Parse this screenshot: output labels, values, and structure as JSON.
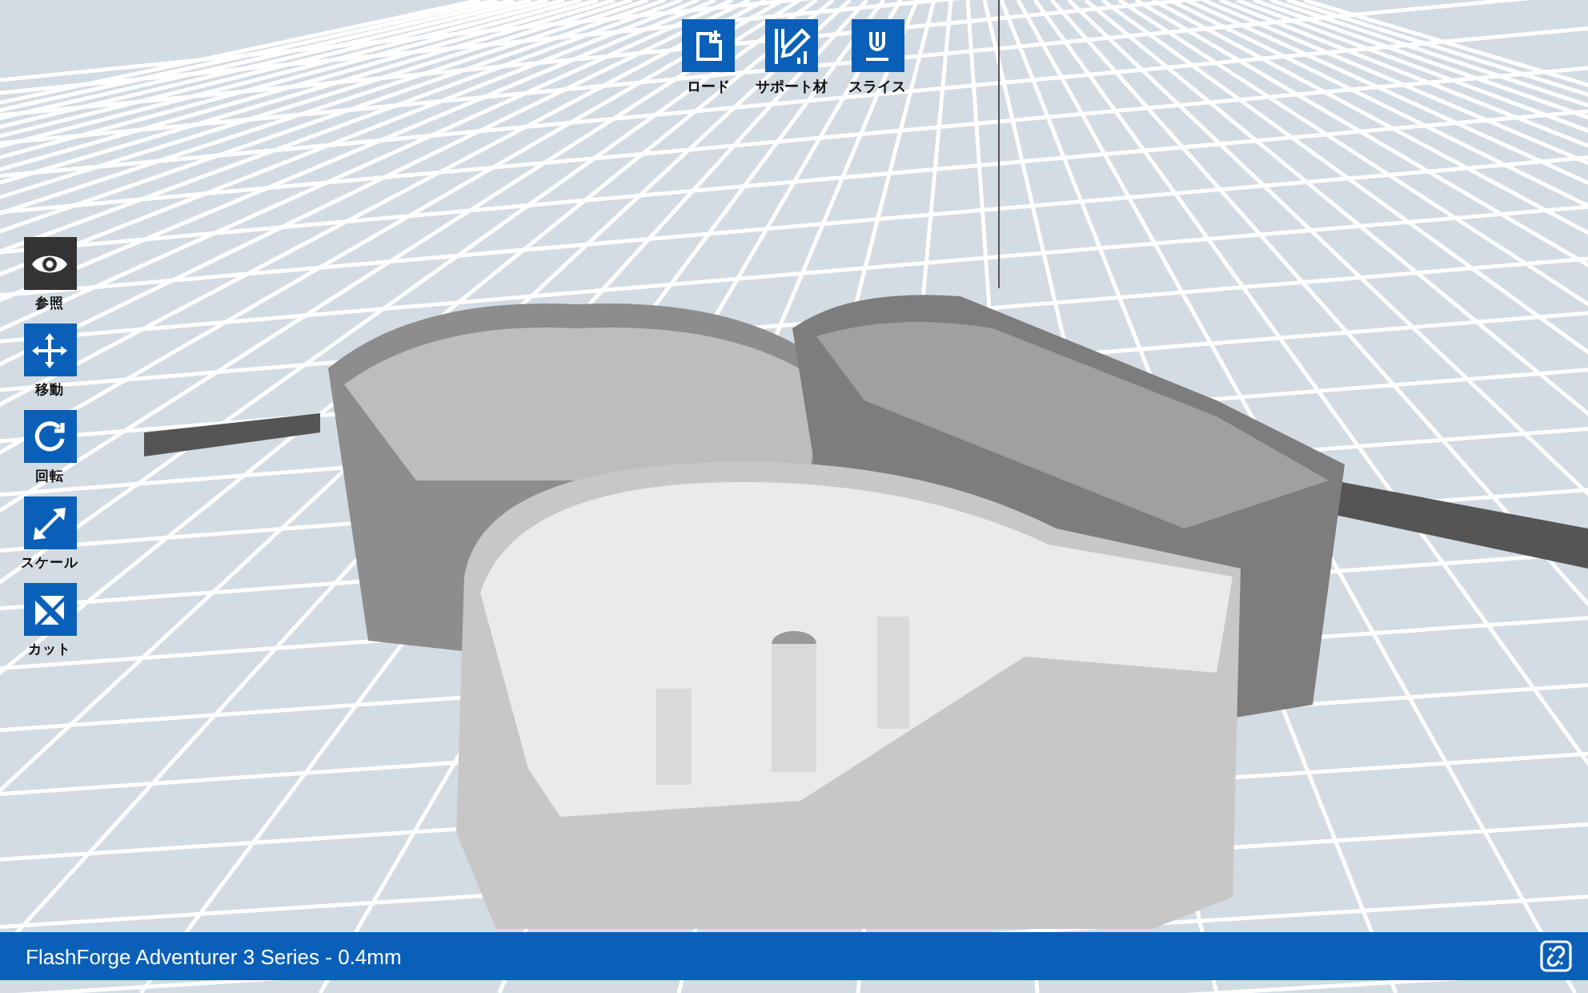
{
  "top_toolbar": [
    {
      "kind": "load",
      "label": "ロード"
    },
    {
      "kind": "support",
      "label": "サポート材"
    },
    {
      "kind": "slice",
      "label": "スライス"
    }
  ],
  "left_toolbar": [
    {
      "kind": "view",
      "label": "参照",
      "selected": true
    },
    {
      "kind": "move",
      "label": "移動",
      "selected": false
    },
    {
      "kind": "rotate",
      "label": "回転",
      "selected": false
    },
    {
      "kind": "scale",
      "label": "スケール",
      "selected": false
    },
    {
      "kind": "cut",
      "label": "カット",
      "selected": false
    }
  ],
  "status_bar": {
    "printer": "FlashForge Adventurer 3 Series - 0.4mm"
  }
}
